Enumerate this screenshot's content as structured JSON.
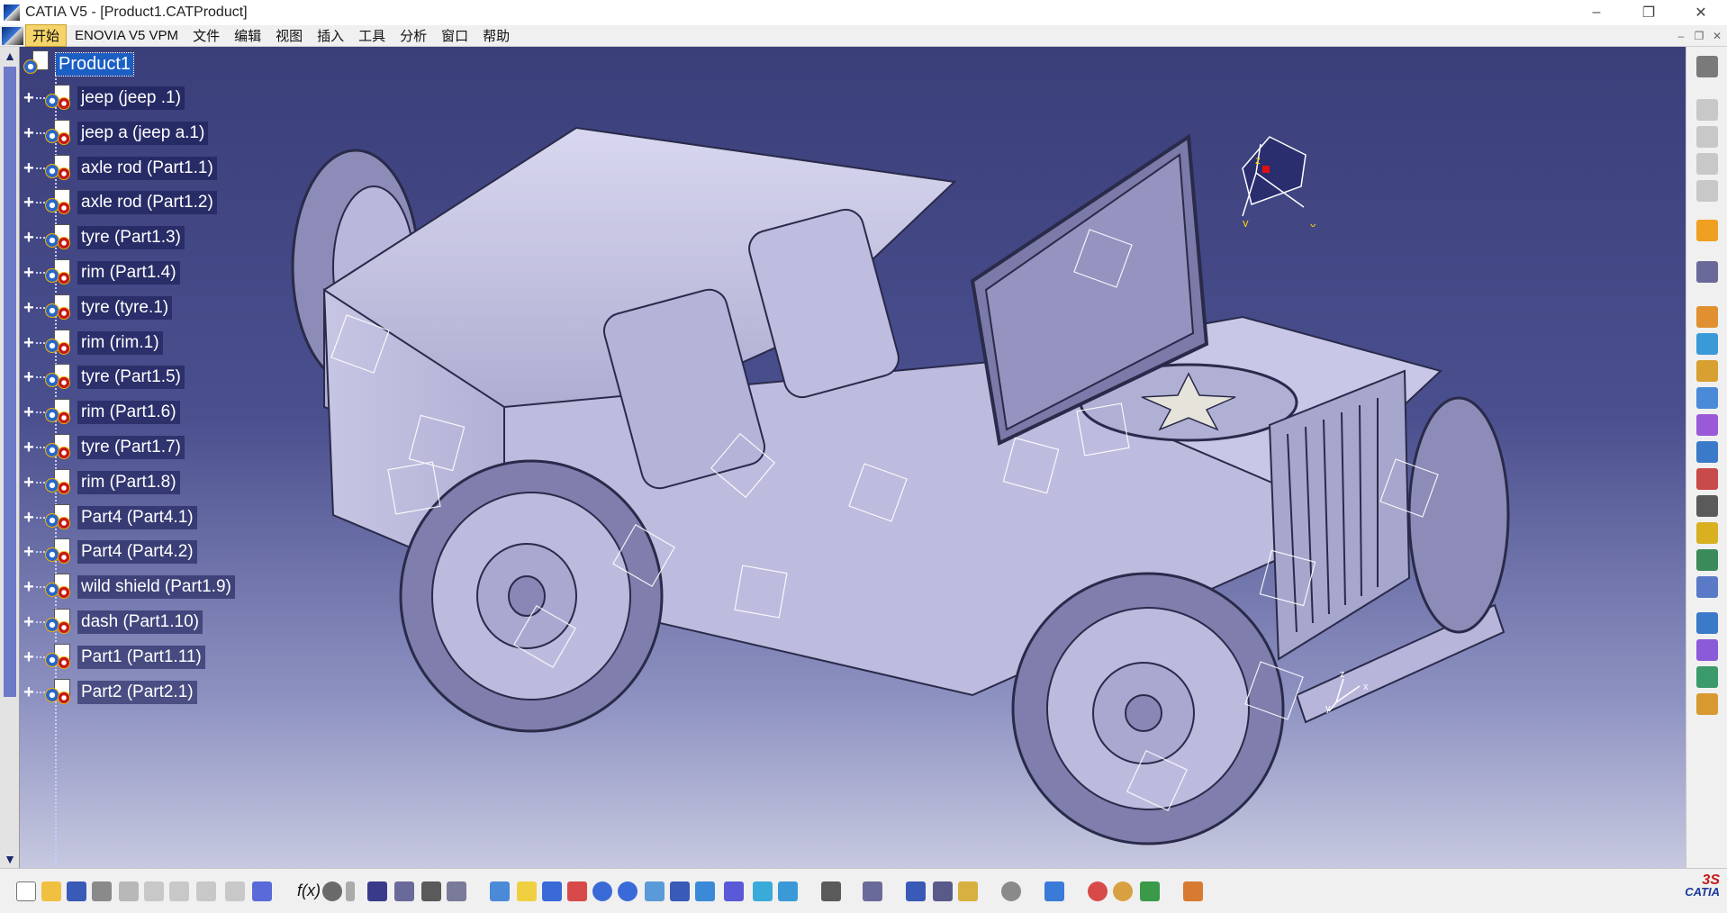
{
  "window": {
    "title": "CATIA V5 - [Product1.CATProduct]",
    "controls": [
      "–",
      "❐",
      "✕"
    ]
  },
  "menu": {
    "items": [
      "开始",
      "ENOVIA V5 VPM",
      "文件",
      "编辑",
      "视图",
      "插入",
      "工具",
      "分析",
      "窗口",
      "帮助"
    ],
    "active": "开始"
  },
  "tree": {
    "root": "Product1",
    "items": [
      "jeep  (jeep .1)",
      "jeep a (jeep a.1)",
      "axle rod (Part1.1)",
      "axle rod (Part1.2)",
      "tyre (Part1.3)",
      "rim (Part1.4)",
      "tyre (tyre.1)",
      "rim (rim.1)",
      "tyre (Part1.5)",
      "rim (Part1.6)",
      "tyre (Part1.7)",
      "rim (Part1.8)",
      "Part4 (Part4.1)",
      "Part4 (Part4.2)",
      "wild shield (Part1.9)",
      "dash (Part1.10)",
      "Part1 (Part1.11)",
      "Part2 (Part2.1)"
    ]
  },
  "compass": {
    "x_label": "x",
    "y_label": "y",
    "z_label": "z"
  },
  "triad": {
    "x_label": "x",
    "y_label": "y",
    "z_label": "z"
  },
  "logo": {
    "ds": "3S",
    "name": "CATIA"
  },
  "colors": {
    "viewport_top": "#3a3f7a",
    "viewport_bottom": "#c7c9e0",
    "model": "#c9c8e6",
    "selection": "#1b5fc4"
  }
}
